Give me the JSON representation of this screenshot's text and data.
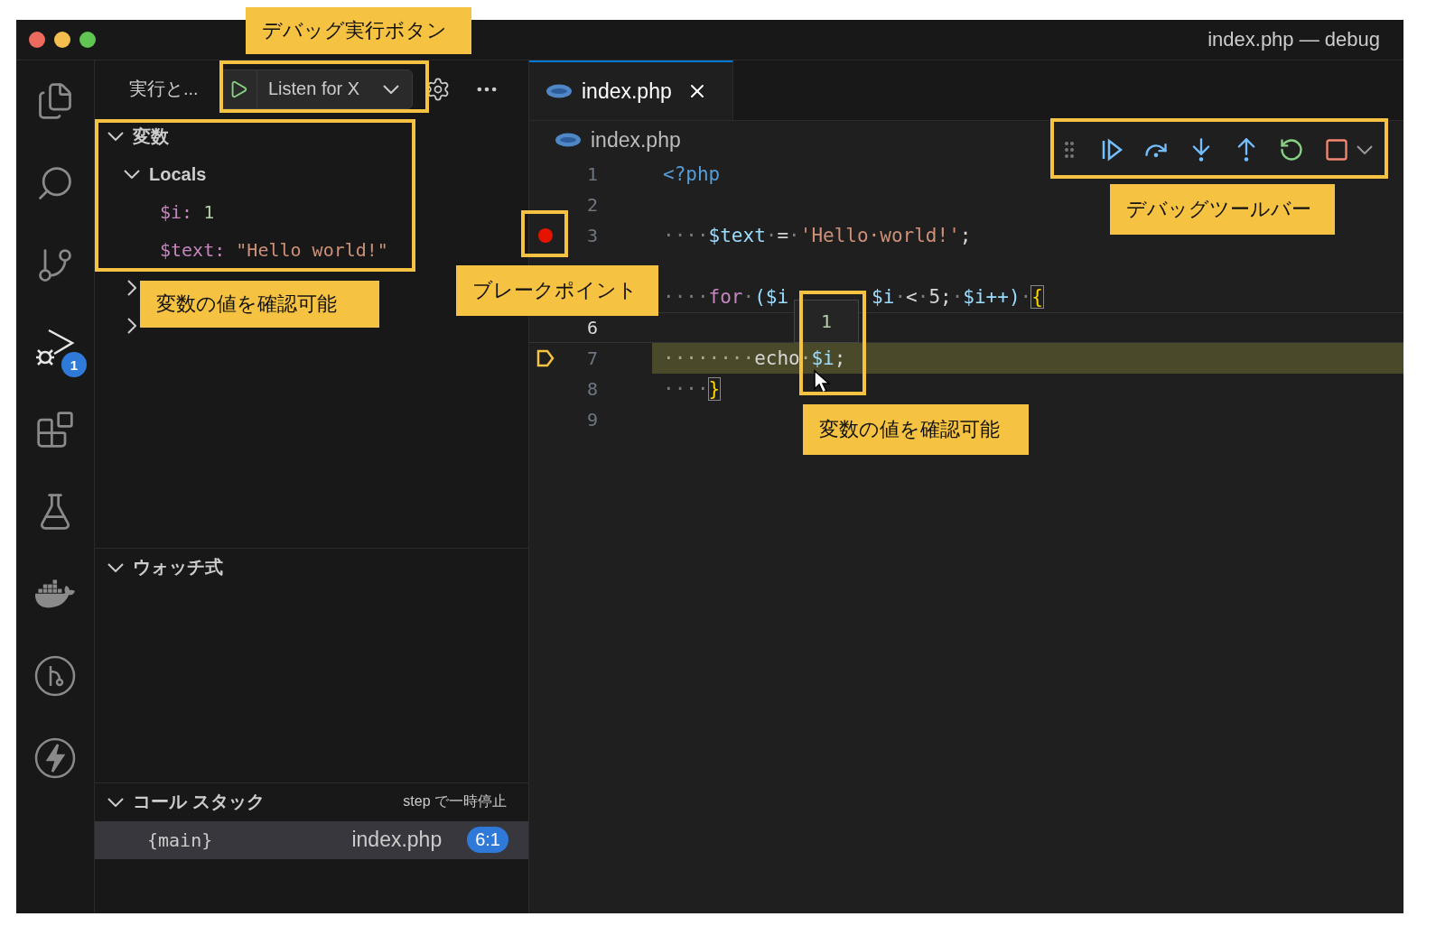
{
  "window": {
    "title": "index.php — debug"
  },
  "activity_bar": {
    "items": [
      {
        "selected": false
      },
      {
        "selected": false
      },
      {
        "selected": false
      },
      {
        "selected": true,
        "badge": "1"
      },
      {
        "selected": false
      },
      {
        "selected": false
      },
      {
        "selected": false
      },
      {
        "selected": false
      },
      {
        "selected": false
      }
    ]
  },
  "sidebar": {
    "title": "実行と...",
    "launch": {
      "label": "Listen for X"
    },
    "variables": {
      "title": "変数",
      "expanded": true,
      "scopes": [
        {
          "label": "Locals",
          "expanded": true,
          "children": [
            {
              "name": "$i:",
              "value": "1",
              "kind": "number"
            },
            {
              "name": "$text:",
              "value": "\"Hello world!\"",
              "kind": "string"
            }
          ]
        },
        {
          "expanded": false
        },
        {
          "expanded": false
        }
      ]
    },
    "watch": {
      "title": "ウォッチ式",
      "expanded": true
    },
    "call_stack": {
      "title": "コール スタック",
      "status": "step で一時停止",
      "expanded": true,
      "frames": [
        {
          "name": "{main}",
          "file": "index.php",
          "position": "6:1",
          "selected": true
        }
      ]
    }
  },
  "editor": {
    "tabs": [
      {
        "label": "index.php",
        "selected": true
      }
    ],
    "breadcrumb": "index.php",
    "lines": [
      {
        "number": "1",
        "breakpoint": false,
        "cursor": false,
        "current": false,
        "tokens": [
          {
            "text": "<?php",
            "kind": "tag"
          }
        ]
      },
      {
        "number": "2",
        "breakpoint": false,
        "cursor": false,
        "current": false
      },
      {
        "number": "3",
        "breakpoint": true,
        "cursor": false,
        "current": false,
        "tokens": [
          {
            "text": "····",
            "kind": "space"
          },
          {
            "text": "$text",
            "kind": "variable"
          },
          {
            "text": "·",
            "kind": "space"
          },
          {
            "text": "=",
            "kind": "plain"
          },
          {
            "text": "·",
            "kind": "space"
          },
          {
            "text": "'Hello·world!'",
            "kind": "string"
          },
          {
            "text": ";",
            "kind": "plain"
          }
        ]
      },
      {
        "breakpoint": false,
        "cursor": false,
        "current": false
      },
      {
        "cursor": false,
        "current": false,
        "tokens": [
          {
            "text": "····",
            "kind": "space"
          },
          {
            "text": "for",
            "kind": "keyword"
          },
          {
            "text": "·",
            "kind": "space"
          },
          {
            "text": "($i",
            "kind": "variable"
          }
        ],
        "after_popup": [
          {
            "text": "$i",
            "kind": "variable"
          },
          {
            "text": "·",
            "kind": "space"
          },
          {
            "text": "<",
            "kind": "plain"
          },
          {
            "text": "·",
            "kind": "space"
          },
          {
            "text": "5;",
            "kind": "plain"
          },
          {
            "text": "·",
            "kind": "space"
          },
          {
            "text": "$i++)",
            "kind": "variable"
          },
          {
            "text": "·",
            "kind": "space"
          },
          {
            "text": "{",
            "kind": "bracket"
          }
        ]
      },
      {
        "number": "6",
        "breakpoint": false,
        "cursor": true,
        "current": false
      },
      {
        "number": "7",
        "breakpoint": false,
        "cursor": false,
        "current": true,
        "tokens": [
          {
            "text": "········",
            "kind": "space"
          },
          {
            "text": "echo",
            "kind": "plain"
          },
          {
            "text": "·",
            "kind": "space"
          },
          {
            "text": "$i",
            "kind": "variable"
          },
          {
            "text": ";",
            "kind": "plain"
          }
        ]
      },
      {
        "number": "8",
        "breakpoint": false,
        "cursor": false,
        "current": false,
        "tokens": [
          {
            "text": "····",
            "kind": "space"
          },
          {
            "text": "}",
            "kind": "bracket"
          }
        ]
      },
      {
        "number": "9",
        "breakpoint": false,
        "cursor": false,
        "current": false
      }
    ],
    "hover": {
      "value": "1"
    }
  },
  "annotations": [
    {
      "text": "デバッグ実行ボタン"
    },
    {
      "text": "変数の値を確認可能"
    },
    {
      "text": "ブレークポイント"
    },
    {
      "text": "デバッグツールバー"
    },
    {
      "text": "変数の値を確認可能"
    }
  ]
}
